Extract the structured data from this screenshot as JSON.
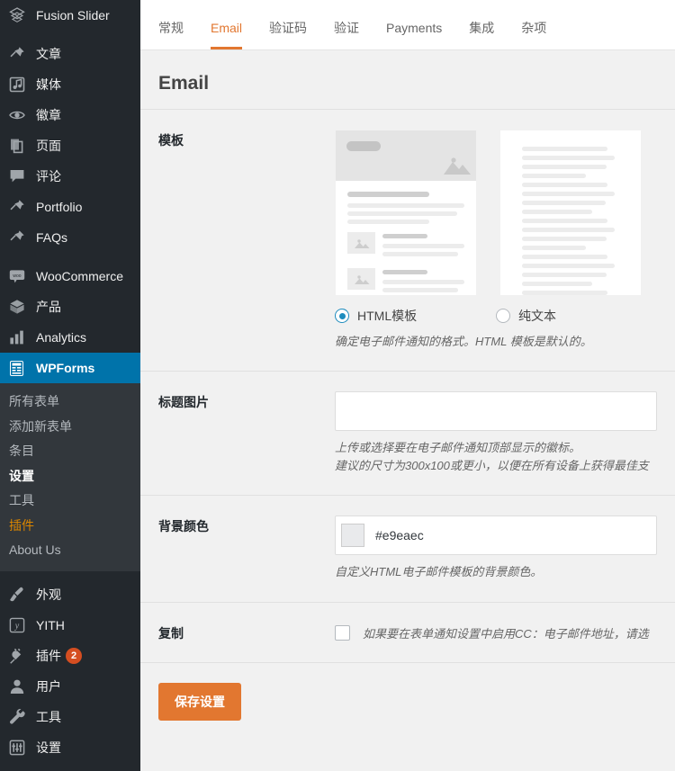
{
  "sidebar": {
    "items": [
      {
        "label": "Fusion Slider",
        "icon": "fusion-slider-icon",
        "gap_after": true
      },
      {
        "label": "文章",
        "icon": "pin-icon"
      },
      {
        "label": "媒体",
        "icon": "media-icon"
      },
      {
        "label": "徽章",
        "icon": "eye-icon"
      },
      {
        "label": "页面",
        "icon": "pages-icon"
      },
      {
        "label": "评论",
        "icon": "comment-icon"
      },
      {
        "label": "Portfolio",
        "icon": "pin-icon"
      },
      {
        "label": "FAQs",
        "icon": "pin-icon",
        "gap_after": true
      },
      {
        "label": "WooCommerce",
        "icon": "woo-icon"
      },
      {
        "label": "产品",
        "icon": "product-icon"
      },
      {
        "label": "Analytics",
        "icon": "chart-icon"
      }
    ],
    "active_item": {
      "label": "WPForms",
      "icon": "wpforms-icon"
    },
    "submenu": [
      {
        "label": "所有表单",
        "state": "normal"
      },
      {
        "label": "添加新表单",
        "state": "normal"
      },
      {
        "label": "条目",
        "state": "normal"
      },
      {
        "label": "设置",
        "state": "current"
      },
      {
        "label": "工具",
        "state": "normal"
      },
      {
        "label": "插件",
        "state": "accent"
      },
      {
        "label": "About Us",
        "state": "normal"
      }
    ],
    "bottom_items": [
      {
        "label": "外观",
        "icon": "brush-icon",
        "badge": ""
      },
      {
        "label": "YITH",
        "icon": "yith-icon",
        "badge": ""
      },
      {
        "label": "插件",
        "icon": "plugin-icon",
        "badge": "2"
      },
      {
        "label": "用户",
        "icon": "user-icon",
        "badge": ""
      },
      {
        "label": "工具",
        "icon": "wrench-icon",
        "badge": ""
      },
      {
        "label": "设置",
        "icon": "settings-icon",
        "badge": ""
      }
    ]
  },
  "tabs": [
    {
      "label": "常规",
      "active": false
    },
    {
      "label": "Email",
      "active": true
    },
    {
      "label": "验证码",
      "active": false
    },
    {
      "label": "验证",
      "active": false
    },
    {
      "label": "Payments",
      "active": false
    },
    {
      "label": "集成",
      "active": false
    },
    {
      "label": "杂项",
      "active": false
    }
  ],
  "panel": {
    "title": "Email"
  },
  "fields": {
    "template": {
      "label": "模板",
      "options": [
        {
          "label": "HTML模板",
          "selected": true,
          "thumb": "html-template-preview"
        },
        {
          "label": "纯文本",
          "selected": false,
          "thumb": "plain-text-preview"
        }
      ],
      "description": "确定电子邮件通知的格式。HTML 模板是默认的。"
    },
    "header_image": {
      "label": "标题图片",
      "value": "",
      "placeholder": "",
      "description_line1": "上传或选择要在电子邮件通知顶部显示的徽标。",
      "description_line2": "建议的尺寸为300x100或更小，以便在所有设备上获得最佳支"
    },
    "background_color": {
      "label": "背景颜色",
      "value": "#e9eaec",
      "swatch_color": "#e9eaec",
      "description": "自定义HTML电子邮件模板的背景颜色。"
    },
    "carbon_copy": {
      "label": "复制",
      "checked": false,
      "description": "如果要在表单通知设置中启用CC：电子邮件地址，请选"
    }
  },
  "actions": {
    "save_label": "保存设置"
  },
  "colors": {
    "accent_orange": "#e27730",
    "admin_blue": "#0073aa",
    "sidebar_bg": "#23282d",
    "submenu_bg": "#32373c",
    "badge_red": "#d54e21",
    "content_bg": "#f1f1f1"
  }
}
